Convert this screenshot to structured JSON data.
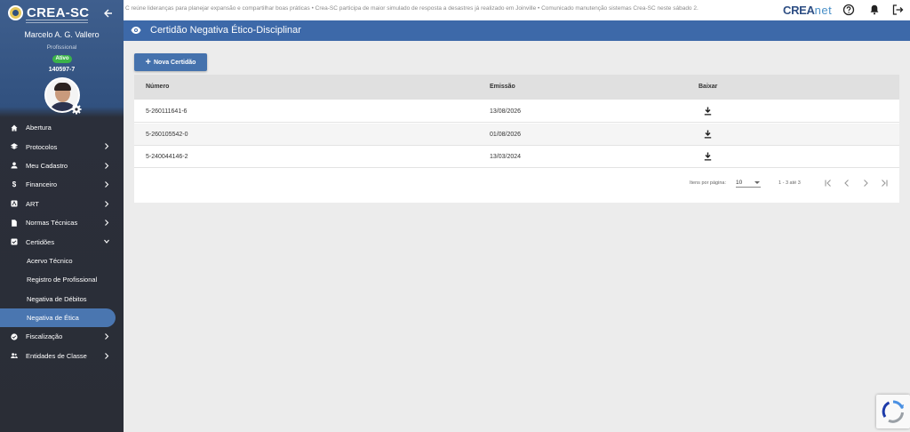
{
  "sidebar": {
    "logo_text": "CREA-SC",
    "user_name": "Marcelo A. G. Vallero",
    "user_role": "Profissional",
    "status_badge": "Ativo",
    "registration": "140597-7",
    "menu": [
      {
        "label": "Abertura",
        "icon": "home-icon",
        "has_chevron": false
      },
      {
        "label": "Protocolos",
        "icon": "layers-icon",
        "has_chevron": true
      },
      {
        "label": "Meu Cadastro",
        "icon": "person-icon",
        "has_chevron": true
      },
      {
        "label": "Financeiro",
        "icon": "dollar-icon",
        "has_chevron": true
      },
      {
        "label": "ART",
        "icon": "art-icon",
        "has_chevron": true
      },
      {
        "label": "Normas Técnicas",
        "icon": "document-icon",
        "has_chevron": true
      },
      {
        "label": "Certidões",
        "icon": "certificate-icon",
        "has_chevron": true,
        "expanded": true
      }
    ],
    "submenu": [
      {
        "label": "Acervo Técnico"
      },
      {
        "label": "Registro de Profissional"
      },
      {
        "label": "Negativa de Débitos"
      },
      {
        "label": "Negativa de Ética",
        "active": true
      }
    ],
    "menu_after": [
      {
        "label": "Fiscalização",
        "icon": "check-circle-icon",
        "has_chevron": true
      },
      {
        "label": "Entidades de Classe",
        "icon": "group-icon",
        "has_chevron": true
      }
    ]
  },
  "topbar": {
    "ticker": "C reúne lideranças para planejar expansão e compartilhar boas práticas • Crea-SC participa de maior simulado de resposta a desastres já realizado em Joinville • Comunicado manutenção sistemas Crea-SC neste sábado 2.",
    "brand_crea": "CREA",
    "brand_net": "net"
  },
  "page": {
    "title": "Certidão Negativa Ético-Disciplinar",
    "new_button_label": "Nova Certidão"
  },
  "table": {
    "headers": {
      "numero": "Número",
      "emissao": "Emissão",
      "baixar": "Baixar"
    },
    "rows": [
      {
        "numero": "5-260111641-6",
        "emissao": "13/08/2026"
      },
      {
        "numero": "5-260105542-0",
        "emissao": "01/08/2026"
      },
      {
        "numero": "5-240044146-2",
        "emissao": "13/03/2024"
      }
    ]
  },
  "pagination": {
    "items_per_page_label": "Itens por página:",
    "items_per_page_value": "10",
    "range_label": "1 - 3 até 3"
  },
  "colors": {
    "sidebar_dark": "#2a2d36",
    "sidebar_top": "#3f5f8e",
    "title_bar": "#3d69a9",
    "primary_button": "#4572ad",
    "active_item": "#4a76b0",
    "badge_green": "#3bb34a"
  }
}
